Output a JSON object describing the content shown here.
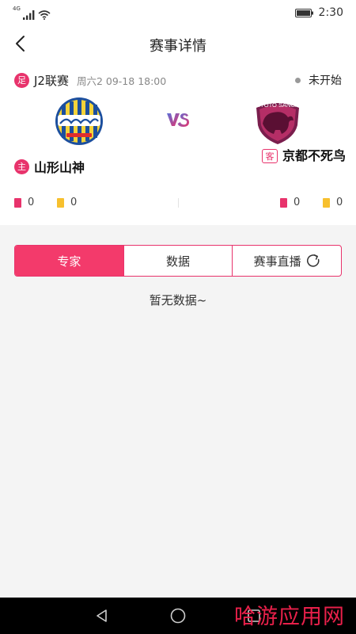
{
  "status_bar": {
    "network": "4G",
    "time": "2:30"
  },
  "header": {
    "title": "赛事详情"
  },
  "match": {
    "sport_badge": "足",
    "league": "J2联赛",
    "time": "周六2 09-18 18:00",
    "status": "未开始",
    "home": {
      "tag": "主",
      "name": "山形山神",
      "red_cards": "0",
      "yellow_cards": "0"
    },
    "away": {
      "tag": "客",
      "name": "京都不死鸟",
      "red_cards": "0",
      "yellow_cards": "0"
    },
    "vs": "VS"
  },
  "tabs": [
    {
      "label": "专家",
      "active": true
    },
    {
      "label": "数据",
      "active": false
    },
    {
      "label": "赛事直播",
      "active": false
    }
  ],
  "empty_message": "暂无数据~",
  "watermark": "哈游应用网",
  "colors": {
    "accent": "#e8336c",
    "tab_active": "#f33a6b",
    "yellow_card": "#f7c02e"
  }
}
